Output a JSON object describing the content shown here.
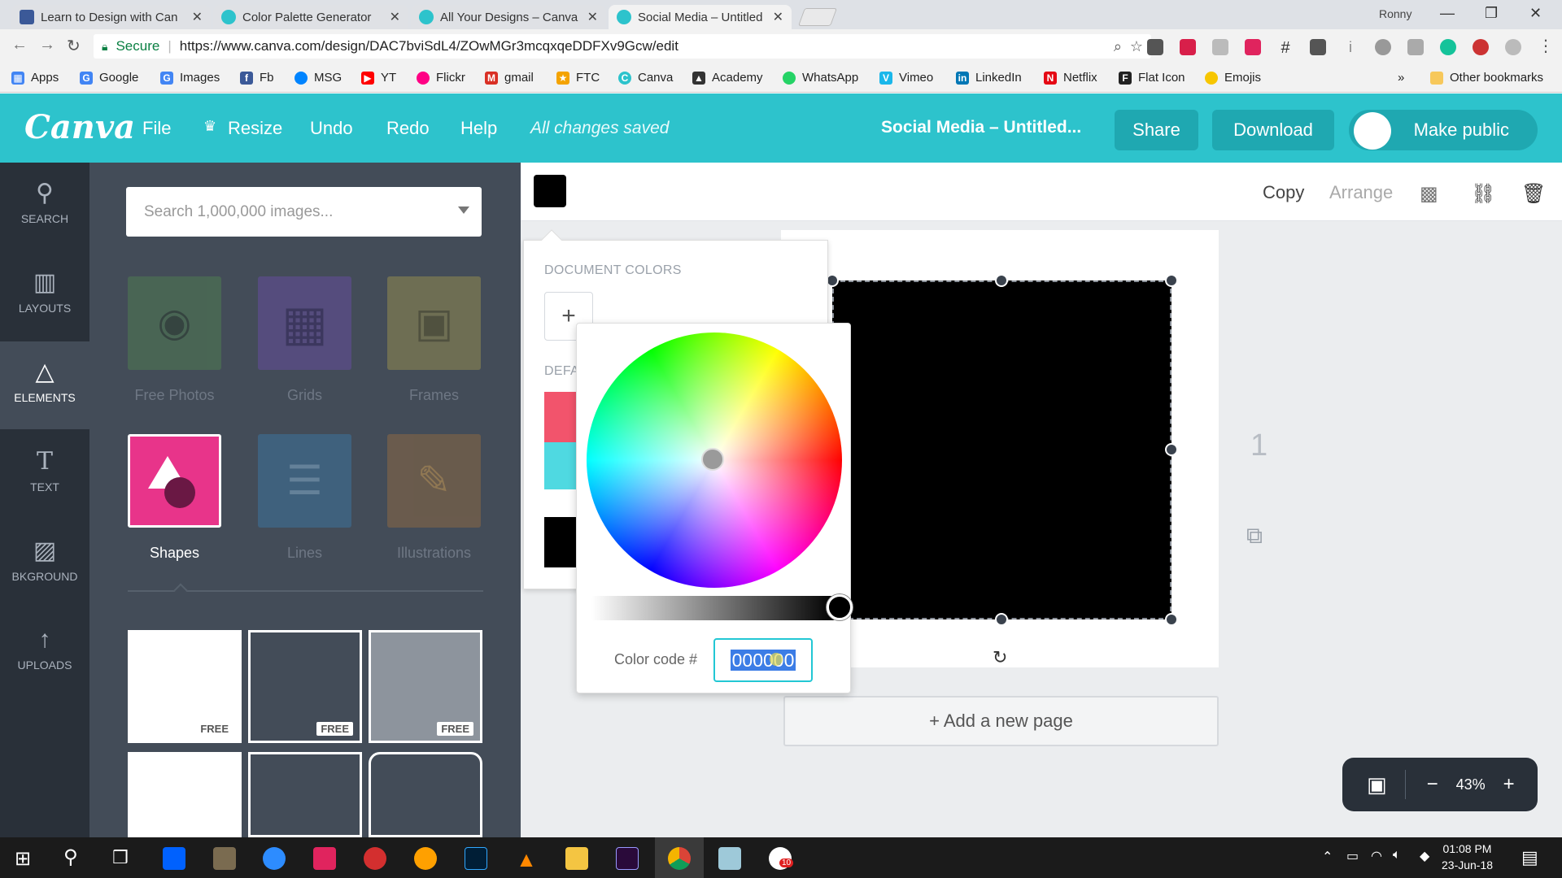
{
  "browser": {
    "tabs": [
      {
        "label": "Learn to Design with Can",
        "icon": "facebook-icon",
        "color": "#3b5998",
        "active": false
      },
      {
        "label": "Color Palette Generator",
        "icon": "canva-icon",
        "color": "#2dc3cc",
        "active": false
      },
      {
        "label": "All Your Designs – Canva",
        "icon": "canva-icon",
        "color": "#2dc3cc",
        "active": false
      },
      {
        "label": "Social Media – Untitled D",
        "icon": "canva-icon",
        "color": "#2dc3cc",
        "active": true
      }
    ],
    "profile": "Ronny",
    "secure_label": "Secure",
    "url": "https://www.canva.com/design/DAC7bviSdL4/ZOwMGr3mcqxqeDDFXv9Gcw/edit",
    "bookmarks": [
      {
        "label": "Apps",
        "color": "#4285f4"
      },
      {
        "label": "Google",
        "color": "#4285f4"
      },
      {
        "label": "Images",
        "color": "#4285f4"
      },
      {
        "label": "Fb",
        "color": "#3b5998"
      },
      {
        "label": "MSG",
        "color": "#0084ff"
      },
      {
        "label": "YT",
        "color": "#ff0000"
      },
      {
        "label": "Flickr",
        "color": "#ff0084"
      },
      {
        "label": "gmail",
        "color": "#d93025"
      },
      {
        "label": "FTC",
        "color": "#f4a300"
      },
      {
        "label": "Canva",
        "color": "#2dc3cc"
      },
      {
        "label": "Academy",
        "color": "#333333"
      },
      {
        "label": "WhatsApp",
        "color": "#25d366"
      },
      {
        "label": "Vimeo",
        "color": "#1ab7ea"
      },
      {
        "label": "LinkedIn",
        "color": "#0077b5"
      },
      {
        "label": "Netflix",
        "color": "#e50914"
      },
      {
        "label": "Flat Icon",
        "color": "#222222"
      },
      {
        "label": "Emojis",
        "color": "#f7c600"
      }
    ],
    "more_bookmarks": "»",
    "other_bookmarks": "Other bookmarks"
  },
  "header": {
    "logo": "Canva",
    "menu": [
      "File",
      "Resize",
      "Undo",
      "Redo",
      "Help"
    ],
    "status": "All changes saved",
    "doc_title": "Social Media – Untitled...",
    "share": "Share",
    "download": "Download",
    "make_public": "Make public",
    "accent": "#2dc3cc"
  },
  "rail": [
    {
      "label": "SEARCH",
      "icon": "search-icon",
      "active": false
    },
    {
      "label": "LAYOUTS",
      "icon": "layouts-icon",
      "active": false
    },
    {
      "label": "ELEMENTS",
      "icon": "elements-icon",
      "active": true
    },
    {
      "label": "TEXT",
      "icon": "text-icon",
      "active": false
    },
    {
      "label": "BKGROUND",
      "icon": "background-icon",
      "active": false
    },
    {
      "label": "UPLOADS",
      "icon": "upload-icon",
      "active": false
    }
  ],
  "panel": {
    "search_placeholder": "Search 1,000,000 images...",
    "categories": [
      {
        "label": "Free Photos",
        "color": "#4e7b52"
      },
      {
        "label": "Grids",
        "color": "#5b4d8a"
      },
      {
        "label": "Frames",
        "color": "#8c8550"
      },
      {
        "label": "Shapes",
        "color": "#e8348a"
      },
      {
        "label": "Lines",
        "color": "#3f6787"
      },
      {
        "label": "Illustrations",
        "color": "#7a6248"
      }
    ],
    "free_badge": "FREE"
  },
  "toolbar": {
    "copy": "Copy",
    "arrange": "Arrange"
  },
  "color_picker": {
    "document_colors_label": "DOCUMENT COLORS",
    "default_colors_label": "DEFA",
    "code_label": "Color code #",
    "code_value": "000000"
  },
  "canvas": {
    "page_number": "1",
    "add_page": "+ Add a new page",
    "zoom": "43%"
  },
  "taskbar": {
    "time": "01:08 PM",
    "date": "23-Jun-18",
    "badge": "10"
  }
}
